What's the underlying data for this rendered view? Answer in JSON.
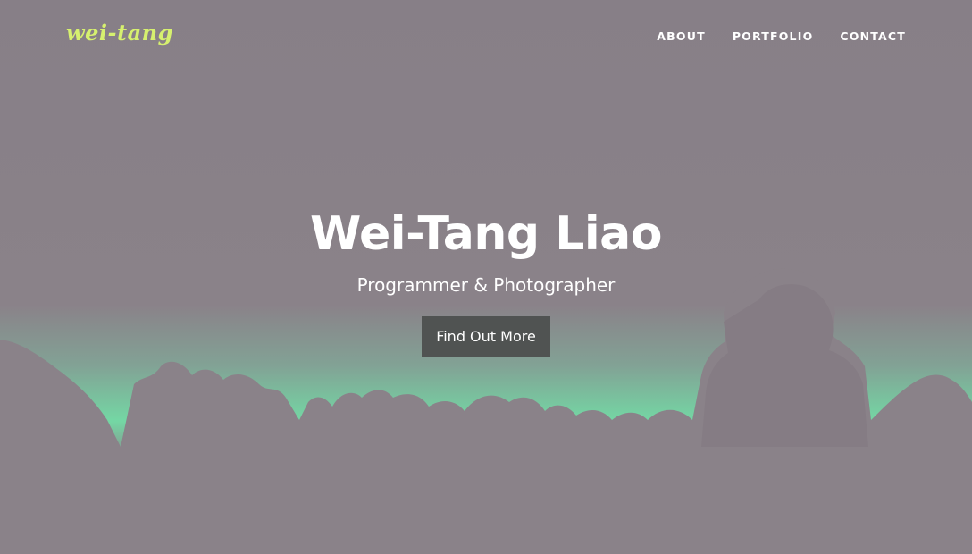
{
  "navbar": {
    "brand": "wei-tang",
    "links": [
      {
        "label": "ABOUT"
      },
      {
        "label": "PORTFOLIO"
      },
      {
        "label": "CONTACT"
      }
    ]
  },
  "hero": {
    "title": "Wei-Tang Liao",
    "subtitle": "Programmer & Photographer",
    "cta_label": "Find Out More"
  },
  "colors": {
    "overlay": "#8a8289",
    "brand": "#d6f06f",
    "sky_glow": "#7ee0a8",
    "button_bg": "#505352",
    "text": "#ffffff"
  }
}
